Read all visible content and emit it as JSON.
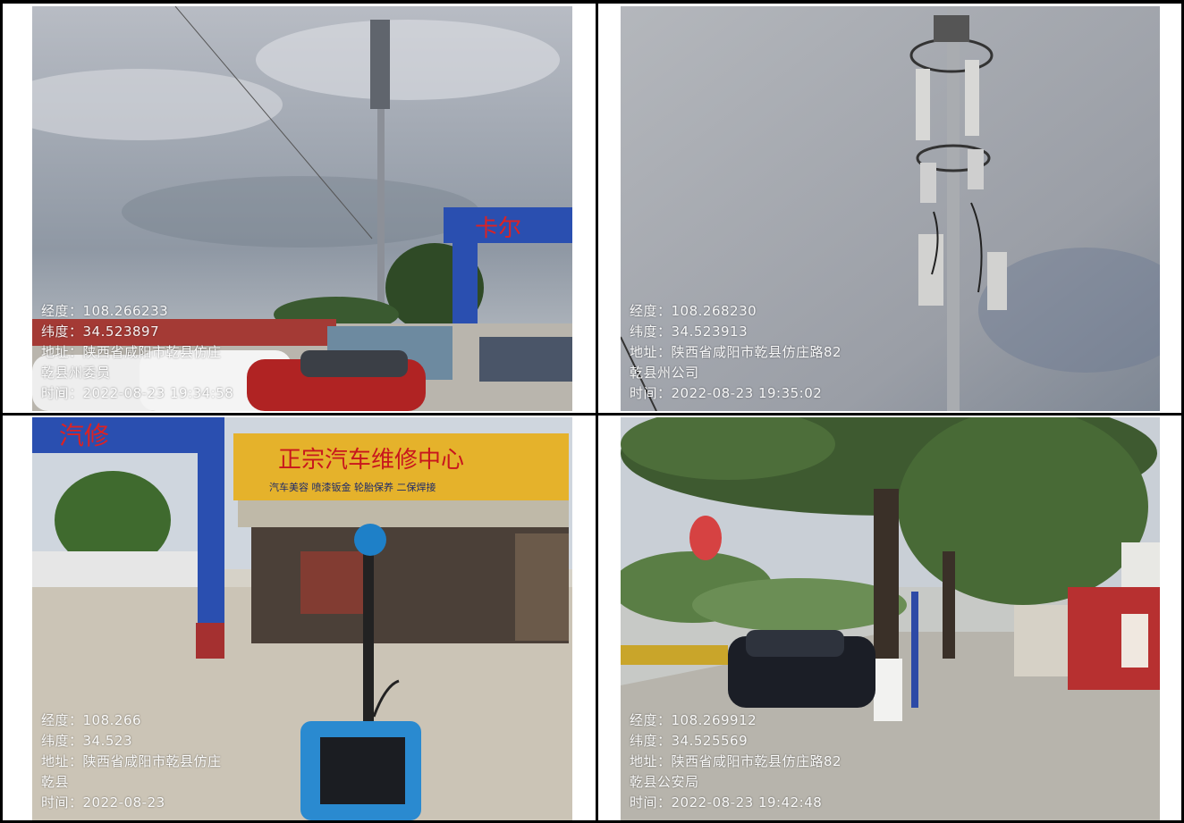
{
  "photos": [
    {
      "name": "tower-wide-photo",
      "overlay": {
        "longitude": "经度：108.266233",
        "latitude": "纬度：34.523897",
        "address": "地址：陕西省咸阳市乾县仿庄",
        "unit": "乾县州委员",
        "time": "时间：2022-08-23 19:34:58"
      },
      "signboard": "卡尔"
    },
    {
      "name": "antenna-closeup-photo",
      "overlay": {
        "longitude": "经度：108.268230",
        "latitude": "纬度：34.523913",
        "address": "地址：陕西省咸阳市乾县仿庄路82",
        "unit": "乾县州公司",
        "time": "时间：2022-08-23 19:35:02"
      }
    },
    {
      "name": "sound-meter-photo",
      "overlay": {
        "longitude": "经度：108.266",
        "latitude": "纬度：34.523",
        "address": "地址：陕西省咸阳市乾县仿庄",
        "unit": "乾县",
        "time": "时间：2022-08-23"
      },
      "gate_text": "汽修",
      "shop_sign": "正宗汽车维修中心",
      "shop_sub": "汽车美容 喷漆钣金 轮胎保养 二保焊接"
    },
    {
      "name": "street-photo",
      "overlay": {
        "longitude": "经度：108.269912",
        "latitude": "纬度：34.525569",
        "address": "地址：陕西省咸阳市乾县仿庄路82",
        "unit": "乾县公安局",
        "time": "时间：2022-08-23 19:42:48"
      }
    }
  ],
  "colors": {
    "sky": "#9aa2aa",
    "blue_gate": "#2a4fb0",
    "sign_yellow": "#e5b22b",
    "car_red": "#b02323"
  }
}
